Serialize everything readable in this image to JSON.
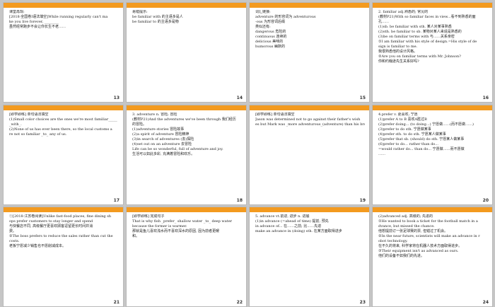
{
  "colors": {
    "accent": "#f39a1f",
    "background": "#c6c6c6",
    "slide": "#ffffff"
  },
  "slides": [
    {
      "num": "13",
      "lines": [
        "课堂再现:",
        "[2018·全国卷Ⅰ语法填空]While running regularly can't ma",
        "ke you live forever, ________",
        "虽然经常跑步不会让你长生不老……"
      ]
    },
    {
      "num": "14",
      "lines": [
        "易错提示:",
        "be familiar with 的主语多是人",
        "be familiar to 的主语多是物"
      ]
    },
    {
      "num": "15",
      "lines": [
        "词汇链接:",
        "adventure 的形容词为 adventurous",
        "-ous 为形容词后缀",
        "类似还有:",
        "dangerous       危险的",
        "continuous   连续的",
        "delicious   美味的",
        "humorous    幽默的"
      ]
    },
    {
      "num": "16",
      "lines": [
        "2. familiar adj.熟悉的; 常见的",
        "(教材P21)With so familiar faces in view...看不到熟悉的面",
        "孔……",
        "(1)sb. be familiar with sth.  某人对某事熟悉",
        "(2)sth. be familiar to sb.   某物对某人来说是熟悉的",
        "(3)be on familiar terms with    与……关系亲密",
        "①I am familiar with his style of design.=His style of de",
        "sign is familiar to me.",
        "我很熟悉他的设计风格。",
        "②Are you on familiar terms with Mr. Johnson?",
        "你和约翰逊先生关系好吗?"
      ]
    },
    {
      "num": "17",
      "lines": [
        "[即学即练]  单句语法填空",
        "(1)Small color choices are the ones we're most familiar_____",
        "_with_.",
        "(2)None of us has ever been there, so the local customs a",
        "re not so familiar _to_ any of us."
      ]
    },
    {
      "num": "18",
      "lines": [
        "3. adventure n. 冒险; 冒险",
        "(教材P21)And the adventures we've been through 我们经历",
        "的冒险。",
        "(1)adventure stories   冒险故事",
        "(2)a spirit of adventure   冒险精神",
        "(3)in search of adventures  (去)探险",
        "(4)set out on an adventure   去冒险",
        "Life can be so wonderful, full of adventure and joy.",
        "生活可以如此多彩, 充满着冒险和欢乐。"
      ]
    },
    {
      "num": "19",
      "lines": [
        "[即学即练]  单句语法填空",
        "Jason was determined not to go against their father's wish",
        "es but Mark was _more adventurous_(adventure) than his brother."
      ]
    },
    {
      "num": "20",
      "lines": [
        "4.prefer v. 更喜欢; 宁愿",
        "(1)prefer A to B  喜欢A胜过B",
        "(2)prefer doing... (to doing...)   宁愿做……(而不愿做……)",
        "(3)prefer to do sth.   宁愿做某事",
        "(4)prefer sth. to do sth.   宁愿某人做某事",
        "(5)prefer that sb. (should) do sth.  宁愿某人做某事",
        "(6)prefer to do... rather than do...",
        "=would rather do... than do...   宁愿做……而不愿做",
        "……"
      ]
    },
    {
      "num": "21",
      "lines": [
        "①[2018·江苏卷阅读]Unlike fast-food places, fine dining sh",
        "ops prefer customers to stay longer and spend",
        "与快餐店不同, 高级餐厅更喜欢顾客逗留更长时间并消",
        "费。",
        "②The boss prefers to reduce the sales rather than cut the",
        "costs.",
        "老板宁愿减少销售也不愿削减成本。"
      ]
    },
    {
      "num": "22",
      "lines": [
        "[即学即练]  完成句子",
        "That is why fish _prefer_ shallow water _to_ deep water",
        " because the former is warmer.",
        "那就是鱼儿喜欢浅水而不喜欢深水的原因, 因为前者更暖",
        "和。"
      ]
    },
    {
      "num": "23",
      "lines": [
        "5. advance vt.前进, 进步  n. 进展",
        "(1)in advance (=ahead of time)  提前; 预先",
        "in advance of... 在……之前; 比……先进",
        "make an advance in (doing) sth.   在某方面取得进步"
      ]
    },
    {
      "num": "24",
      "lines": [
        "(2)advanced adj.  高级的; 先进的",
        "①He wanted to book a ticket for the football match in a",
        "dvance, but missed the chance.",
        "他想提前订一张足球赛的票, 但错过了机会。",
        "②In the near future, scientists will make an advance in r",
        "obot technology.",
        "在不久的将来, 科学家将在机器人技术方面取得进步。",
        "③Their equipment isn't as advanced as ours.",
        "他们的设备不如我们的先进。"
      ]
    }
  ]
}
